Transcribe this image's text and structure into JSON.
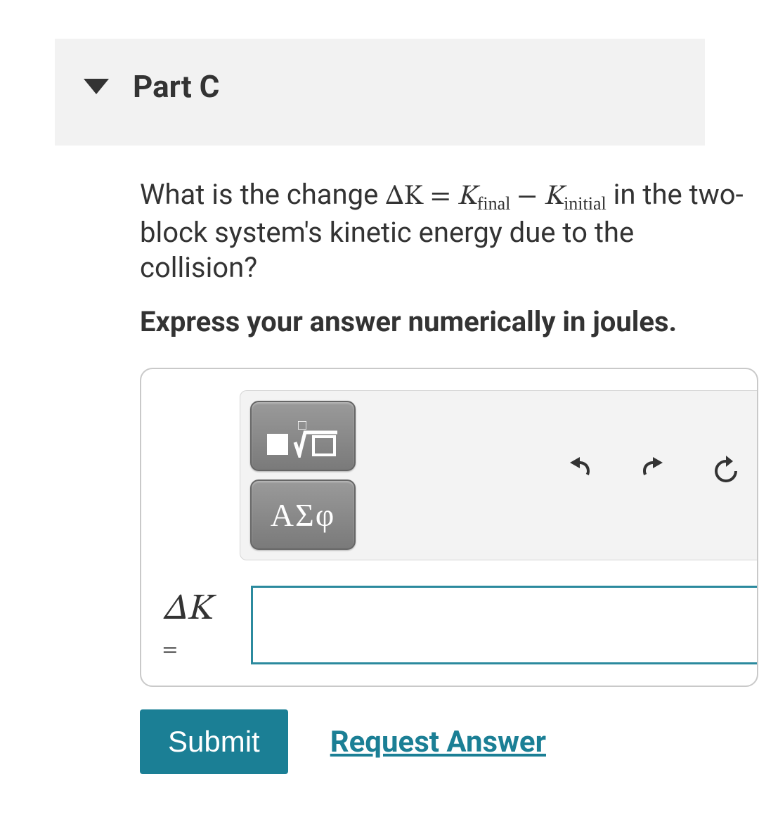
{
  "part": {
    "label": "Part C"
  },
  "question": {
    "lead": "What is the change ",
    "equation": {
      "deltaK": "ΔK",
      "eq": " = ",
      "k1": "K",
      "sub1": "final",
      "minus": " − ",
      "k2": "K",
      "sub2": "initial"
    },
    "rest": " in the two-block system's kinetic energy due to the collision?"
  },
  "instruction": "Express your answer numerically in joules.",
  "toolbar": {
    "math_tool": "math-template",
    "greek_tool": "ΑΣφ"
  },
  "answer": {
    "var": "ΔK",
    "eq": "=",
    "value": ""
  },
  "actions": {
    "submit": "Submit",
    "request": "Request Answer"
  }
}
